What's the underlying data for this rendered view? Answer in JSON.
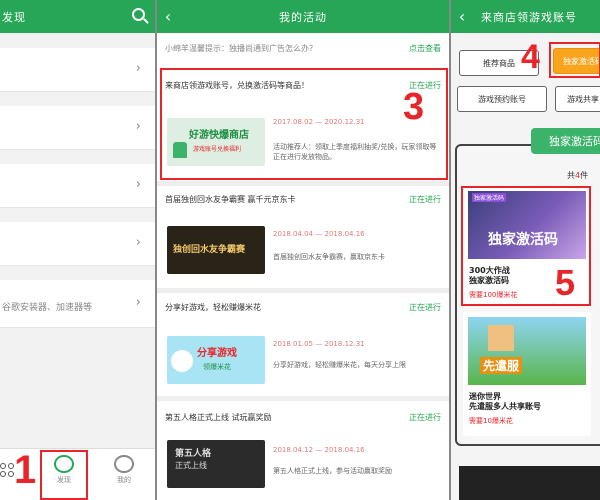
{
  "panel1": {
    "title": "发现",
    "footer_text": "谷歌安装器、加速器等",
    "nav": [
      {
        "label": "发现"
      },
      {
        "label": "我的"
      }
    ],
    "annotation": "1"
  },
  "panel2": {
    "title": "我的活动",
    "tip": "小绵羊温馨提示：独播尚通到广告怎么办?",
    "tip_link": "点击查看",
    "annotation": "3",
    "activities": [
      {
        "title": "来商店领游戏账号，兑换激活码等商品！",
        "status": "正在进行",
        "date": "2017.08.02 — 2020.12.31",
        "desc": "活动推荐人：领取上季度福利抽奖/兑换，玩家领取等正在进行发放物品。",
        "thumb_text": "好游快爆商店",
        "thumb_sub": "游戏账号兑换福利"
      },
      {
        "title": "首届独创回水友争霸赛 赢千元京东卡",
        "status": "正在进行",
        "date": "2018.04.04 — 2018.04.16",
        "desc": "首届独创回水友争霸赛，赢取京东卡",
        "thumb_text": "独创回水友争霸赛",
        "thumb_sub": ""
      },
      {
        "title": "分享好游戏，轻松赚爆米花",
        "status": "正在进行",
        "date": "2018.01.05 — 2018.12.31",
        "desc": "分享好游戏，轻松赚爆米花，每天分享上限",
        "thumb_text": "分享游戏",
        "thumb_sub": "领爆米花"
      },
      {
        "title": "第五人格正式上线 试玩赢奖励",
        "status": "正在进行",
        "date": "2018.04.12 — 2018.04.16",
        "desc": "第五人格正式上线，参与活动赢取奖励",
        "thumb_text": "第五人格",
        "thumb_sub": "正式上线"
      }
    ]
  },
  "panel3": {
    "title": "来商店领游戏账号",
    "tabs": [
      {
        "label": "推荐商品"
      },
      {
        "label": "独家激活码"
      },
      {
        "label": "游戏预约账号"
      },
      {
        "label": "游戏共享"
      }
    ],
    "section_label": "独家激活码",
    "count_prefix": "共",
    "count_num": "4",
    "count_suffix": "件",
    "annotation_tab": "4",
    "annotation_item": "5",
    "items": [
      {
        "name": "300大作战\n独家激活码",
        "price": "需要100爆米花",
        "badge": "独家激活码"
      },
      {
        "name": "迷你世界\n先遣服多人共享账号",
        "price": "需要10爆米花",
        "badge": "先遣服"
      }
    ]
  },
  "colors": {
    "primary": "#26a656",
    "accent": "#f8a41c",
    "annotation": "#e8262a"
  }
}
